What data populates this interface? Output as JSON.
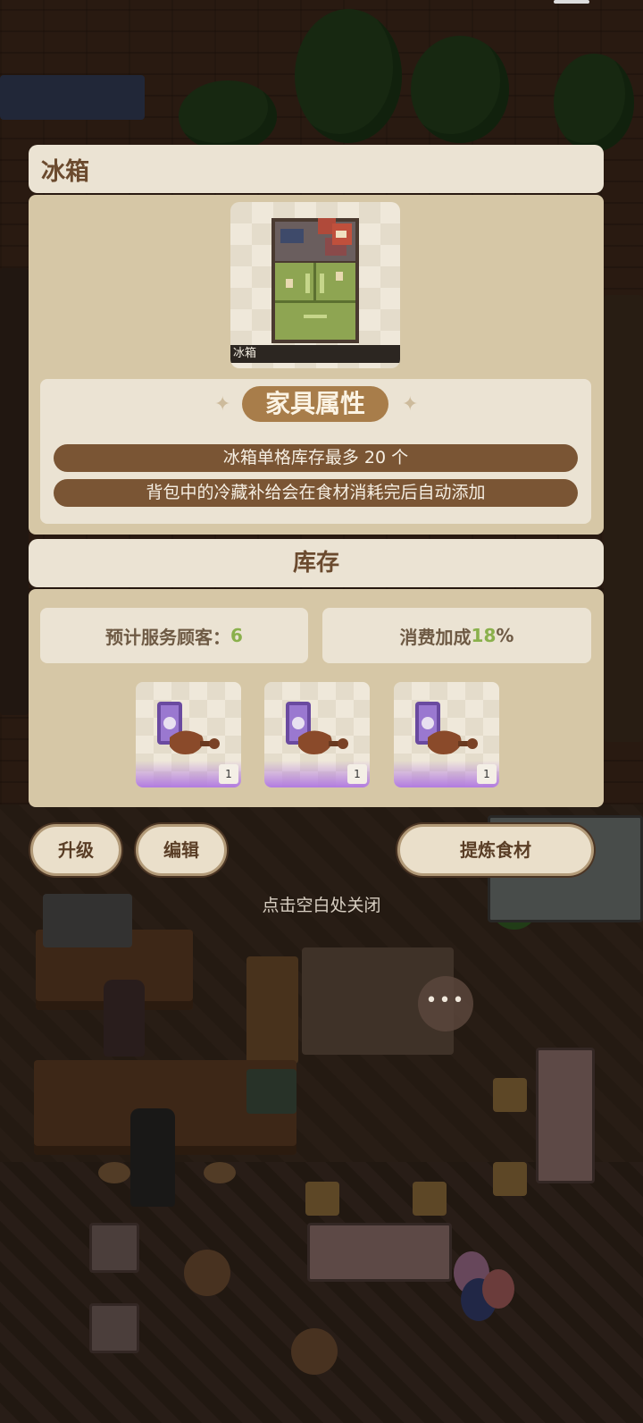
{
  "dialog": {
    "title": "冰箱",
    "preview": {
      "caption": "冰箱",
      "icon": "fridge-icon"
    },
    "attributes": {
      "title": "家具属性",
      "lines": [
        "冰箱单格库存最多 20 个",
        "背包中的冷藏补给会在食材消耗完后自动添加"
      ]
    },
    "inventory": {
      "title": "库存",
      "stats": {
        "customers_label": "预计服务顾客：",
        "customers_value": "6",
        "bonus_label": "消费加成",
        "bonus_value": "18",
        "bonus_unit": "%"
      },
      "slots": [
        {
          "icon": "chicken-leg-supply-icon",
          "count": "1"
        },
        {
          "icon": "chicken-leg-supply-icon",
          "count": "1"
        },
        {
          "icon": "chicken-leg-supply-icon",
          "count": "1"
        }
      ]
    },
    "buttons": {
      "upgrade": "升级",
      "edit": "编辑",
      "refine": "提炼食材"
    },
    "close_hint": "点击空白处关闭"
  },
  "scene": {
    "more_button": "•••"
  },
  "colors": {
    "panel": "#d6c7a6",
    "panel_light": "#ebe3d3",
    "pill": "#7a5534",
    "accent_tag": "#a87d4a",
    "value_green": "#8ab04c",
    "rarity_purple": "#b27be0"
  }
}
